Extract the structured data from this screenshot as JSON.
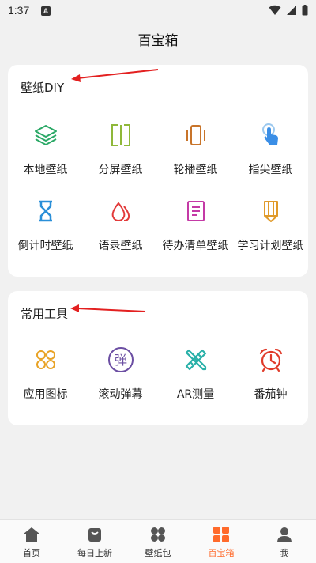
{
  "status": {
    "time": "1:37",
    "notif_glyph": "A"
  },
  "header": {
    "title": "百宝箱"
  },
  "sections": [
    {
      "title": "壁纸DIY",
      "items": [
        {
          "label": "本地壁纸",
          "icon": "layers-icon"
        },
        {
          "label": "分屏壁纸",
          "icon": "split-screen-icon"
        },
        {
          "label": "轮播壁纸",
          "icon": "carousel-icon"
        },
        {
          "label": "指尖壁纸",
          "icon": "finger-tap-icon"
        },
        {
          "label": "倒计时壁纸",
          "icon": "hourglass-icon"
        },
        {
          "label": "语录壁纸",
          "icon": "drops-icon"
        },
        {
          "label": "待办清单壁纸",
          "icon": "todo-list-icon"
        },
        {
          "label": "学习计划壁纸",
          "icon": "pencil-icon"
        }
      ]
    },
    {
      "title": "常用工具",
      "items": [
        {
          "label": "应用图标",
          "icon": "app-grid-icon"
        },
        {
          "label": "滚动弹幕",
          "icon": "danmaku-icon",
          "glyph": "弹"
        },
        {
          "label": "AR测量",
          "icon": "ruler-pencil-icon"
        },
        {
          "label": "番茄钟",
          "icon": "alarm-clock-icon"
        }
      ]
    }
  ],
  "tabs": [
    {
      "label": "首页",
      "icon": "home-icon",
      "active": false
    },
    {
      "label": "每日上新",
      "icon": "bag-icon",
      "active": false
    },
    {
      "label": "壁纸包",
      "icon": "grid-icon",
      "active": false
    },
    {
      "label": "百宝箱",
      "icon": "toolbox-icon",
      "active": true
    },
    {
      "label": "我",
      "icon": "person-icon",
      "active": false
    }
  ],
  "colors": {
    "accent": "#ff6a2b",
    "annotation_arrow": "#e32020"
  }
}
